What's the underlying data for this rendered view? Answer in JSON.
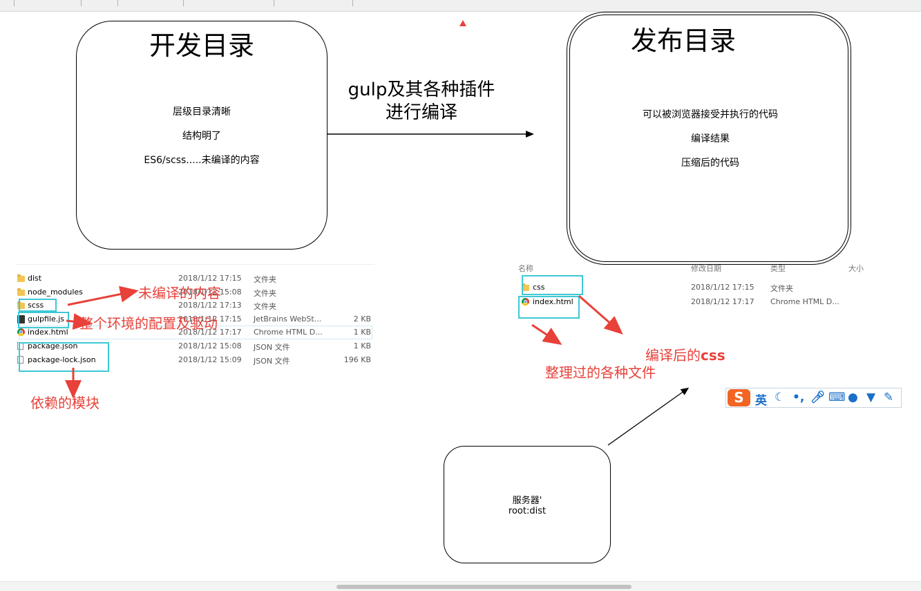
{
  "dev_box": {
    "title": "开发目录",
    "lines": [
      "层级目录清晰",
      "结构明了",
      "ES6/scss.....未编译的内容"
    ]
  },
  "release_box": {
    "title": "发布目录",
    "lines": [
      "可以被浏览器接受并执行的代码",
      "编译结果",
      "压缩后的代码"
    ]
  },
  "arrow_label": {
    "line1": "gulp及其各种插件",
    "line2": "进行编译"
  },
  "server_box": {
    "line1": "服务器'",
    "line2": "root:dist"
  },
  "dev_files": [
    {
      "name": "dist",
      "date": "2018/1/12 17:15",
      "type": "文件夹",
      "size": "",
      "icon": "folder-icon"
    },
    {
      "name": "node_modules",
      "date": "2018/1/12 15:08",
      "type": "文件夹",
      "size": "",
      "icon": "folder-icon"
    },
    {
      "name": "scss",
      "date": "2018/1/12 17:13",
      "type": "文件夹",
      "size": "",
      "icon": "folder-icon"
    },
    {
      "name": "gulpfile.js",
      "date": "2018/1/12 17:15",
      "type": "JetBrains WebSt...",
      "size": "2 KB",
      "icon": "js-file-icon"
    },
    {
      "name": "index.html",
      "date": "2018/1/12 17:17",
      "type": "Chrome HTML D...",
      "size": "1 KB",
      "icon": "chrome-icon"
    },
    {
      "name": "package.json",
      "date": "2018/1/12 15:08",
      "type": "JSON 文件",
      "size": "1 KB",
      "icon": "document-icon"
    },
    {
      "name": "package-lock.json",
      "date": "2018/1/12 15:09",
      "type": "JSON 文件",
      "size": "196 KB",
      "icon": "document-icon"
    }
  ],
  "release_headers": {
    "name": "名称",
    "date": "修改日期",
    "type": "类型",
    "size": "大小"
  },
  "release_files": [
    {
      "name": "css",
      "date": "2018/1/12 17:15",
      "type": "文件夹",
      "icon": "folder-icon"
    },
    {
      "name": "index.html",
      "date": "2018/1/12 17:17",
      "type": "Chrome HTML D...",
      "icon": "chrome-icon"
    }
  ],
  "annotations": {
    "uncompiled": "未编译的内容",
    "config": "整个环境的配置及驱动",
    "deps": "依赖的模块",
    "compiled_css_prefix": "编译后的",
    "compiled_css_bold": "css",
    "organized": "整理过的各种文件"
  },
  "ime": {
    "lang": "英",
    "logo": "S"
  },
  "colors": {
    "annotation": "#e8413a",
    "highlight": "#3cc8d6"
  }
}
